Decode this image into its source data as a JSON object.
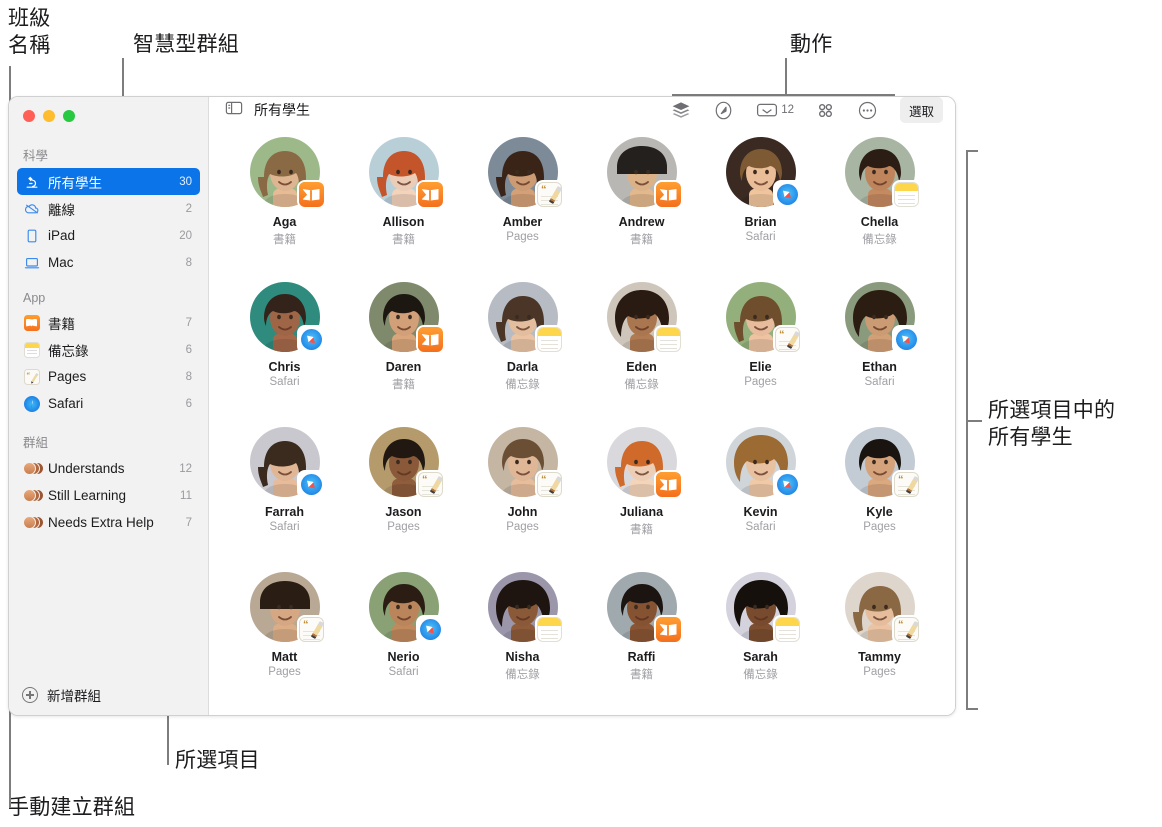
{
  "annotations": {
    "class_name": "班級\n名稱",
    "smart_group": "智慧型群組",
    "actions": "動作",
    "all_students_in_selection": "所選項目中的\n所有學生",
    "selected_item": "所選項目",
    "manual_group": "手動建立群組"
  },
  "window": {
    "traffic_lights": [
      "close",
      "minimize",
      "zoom"
    ]
  },
  "sidebar": {
    "sections": [
      {
        "title": "科學",
        "items": [
          {
            "label": "所有學生",
            "count": "30",
            "icon": "microscope-icon",
            "selected": true
          },
          {
            "label": "離線",
            "count": "2",
            "icon": "cloud-slash-icon",
            "selected": false
          },
          {
            "label": "iPad",
            "count": "20",
            "icon": "ipad-icon",
            "selected": false
          },
          {
            "label": "Mac",
            "count": "8",
            "icon": "mac-icon",
            "selected": false
          }
        ]
      },
      {
        "title": "App",
        "items": [
          {
            "label": "書籍",
            "count": "7",
            "icon": "books-app-icon",
            "selected": false
          },
          {
            "label": "備忘錄",
            "count": "6",
            "icon": "notes-app-icon",
            "selected": false
          },
          {
            "label": "Pages",
            "count": "8",
            "icon": "pages-app-icon",
            "selected": false
          },
          {
            "label": "Safari",
            "count": "6",
            "icon": "safari-app-icon",
            "selected": false
          }
        ]
      },
      {
        "title": "群組",
        "items": [
          {
            "label": "Understands",
            "count": "12",
            "icon": "group-avatars-icon",
            "selected": false
          },
          {
            "label": "Still Learning",
            "count": "11",
            "icon": "group-avatars-icon",
            "selected": false
          },
          {
            "label": "Needs Extra Help",
            "count": "7",
            "icon": "group-avatars-icon",
            "selected": false
          }
        ]
      }
    ],
    "add_group_label": "新增群組"
  },
  "toolbar": {
    "sidebar_toggle_icon": "sidebar-toggle-icon",
    "title": "所有學生",
    "actions": [
      {
        "name": "layers-icon",
        "label": ""
      },
      {
        "name": "navigate-icon",
        "label": ""
      },
      {
        "name": "inbox-icon",
        "label": "12"
      },
      {
        "name": "grid-apps-icon",
        "label": ""
      },
      {
        "name": "more-ellipsis-icon",
        "label": ""
      }
    ],
    "inbox_count": "12",
    "select_label": "選取"
  },
  "students": [
    {
      "name": "Aga",
      "app": "書籍",
      "badge": "books",
      "hair": "#8a6a45",
      "skin": "#e6bb96",
      "bg": "#9db98a",
      "style": "long"
    },
    {
      "name": "Allison",
      "app": "書籍",
      "badge": "books",
      "hair": "#c4542a",
      "skin": "#f3d3bc",
      "bg": "#b9cfd8",
      "style": "long"
    },
    {
      "name": "Amber",
      "app": "Pages",
      "badge": "pages",
      "hair": "#3a2418",
      "skin": "#d3a077",
      "bg": "#7d8b98",
      "style": "long"
    },
    {
      "name": "Andrew",
      "app": "書籍",
      "badge": "books",
      "hair": "#24201d",
      "skin": "#e3b88d",
      "bg": "#b9b7b3",
      "style": "hat"
    },
    {
      "name": "Brian",
      "app": "Safari",
      "badge": "safari",
      "hair": "#7d5a33",
      "skin": "#f0c49c",
      "bg": "#3a2a22",
      "style": "short"
    },
    {
      "name": "Chella",
      "app": "備忘錄",
      "badge": "notes",
      "hair": "#2c1d14",
      "skin": "#c58a60",
      "bg": "#a9b5a3",
      "style": "short"
    },
    {
      "name": "Chris",
      "app": "Safari",
      "badge": "safari",
      "hair": "#33231a",
      "skin": "#a5694a",
      "bg": "#2e8b7e",
      "style": "short"
    },
    {
      "name": "Daren",
      "app": "書籍",
      "badge": "books",
      "hair": "#1d1712",
      "skin": "#d9a67c",
      "bg": "#7e8a6b",
      "style": "short"
    },
    {
      "name": "Darla",
      "app": "備忘錄",
      "badge": "notes",
      "hair": "#4a3527",
      "skin": "#eac4a4",
      "bg": "#b6bbc4",
      "style": "long"
    },
    {
      "name": "Eden",
      "app": "備忘錄",
      "badge": "notes",
      "hair": "#2a1b12",
      "skin": "#b07a52",
      "bg": "#cfc6bb",
      "style": "curly"
    },
    {
      "name": "Elie",
      "app": "Pages",
      "badge": "pages",
      "hair": "#6f4e2d",
      "skin": "#eec3a2",
      "bg": "#93b07c",
      "style": "long"
    },
    {
      "name": "Ethan",
      "app": "Safari",
      "badge": "safari",
      "hair": "#2c1d13",
      "skin": "#d2a077",
      "bg": "#8a9b7d",
      "style": "curly"
    },
    {
      "name": "Farrah",
      "app": "Safari",
      "badge": "safari",
      "hair": "#3b2a1e",
      "skin": "#e8bc9a",
      "bg": "#c8c8ce",
      "style": "long"
    },
    {
      "name": "Jason",
      "app": "Pages",
      "badge": "pages",
      "hair": "#221812",
      "skin": "#8f5c3c",
      "bg": "#b59a6c",
      "style": "short"
    },
    {
      "name": "John",
      "app": "Pages",
      "badge": "pages",
      "hair": "#6b4f35",
      "skin": "#e7bd9b",
      "bg": "#c5b5a3",
      "style": "short"
    },
    {
      "name": "Juliana",
      "app": "書籍",
      "badge": "books",
      "hair": "#d06a2a",
      "skin": "#f5d5ba",
      "bg": "#d9d9dd",
      "style": "long"
    },
    {
      "name": "Kevin",
      "app": "Safari",
      "badge": "safari",
      "hair": "#9c6a33",
      "skin": "#f0c9a6",
      "bg": "#cfd5d8",
      "style": "curly"
    },
    {
      "name": "Kyle",
      "app": "Pages",
      "badge": "pages",
      "hair": "#191410",
      "skin": "#dba97f",
      "bg": "#c3cbd4",
      "style": "short"
    },
    {
      "name": "Matt",
      "app": "Pages",
      "badge": "pages",
      "hair": "#2a1d14",
      "skin": "#dcae88",
      "bg": "#b9a894",
      "style": "hat"
    },
    {
      "name": "Nerio",
      "app": "Safari",
      "badge": "safari",
      "hair": "#2b1d13",
      "skin": "#c08a5e",
      "bg": "#89a175",
      "style": "short"
    },
    {
      "name": "Nisha",
      "app": "備忘錄",
      "badge": "notes",
      "hair": "#1e1511",
      "skin": "#8e5c3a",
      "bg": "#9b96aa",
      "style": "curly"
    },
    {
      "name": "Raffi",
      "app": "書籍",
      "badge": "books",
      "hair": "#1c1410",
      "skin": "#8a5534",
      "bg": "#9fa9ae",
      "style": "short"
    },
    {
      "name": "Sarah",
      "app": "備忘錄",
      "badge": "notes",
      "hair": "#16100c",
      "skin": "#7d4e30",
      "bg": "#d3d2dd",
      "style": "curly"
    },
    {
      "name": "Tammy",
      "app": "Pages",
      "badge": "pages",
      "hair": "#8a6843",
      "skin": "#edc4a3",
      "bg": "#ded6cc",
      "style": "long"
    }
  ]
}
